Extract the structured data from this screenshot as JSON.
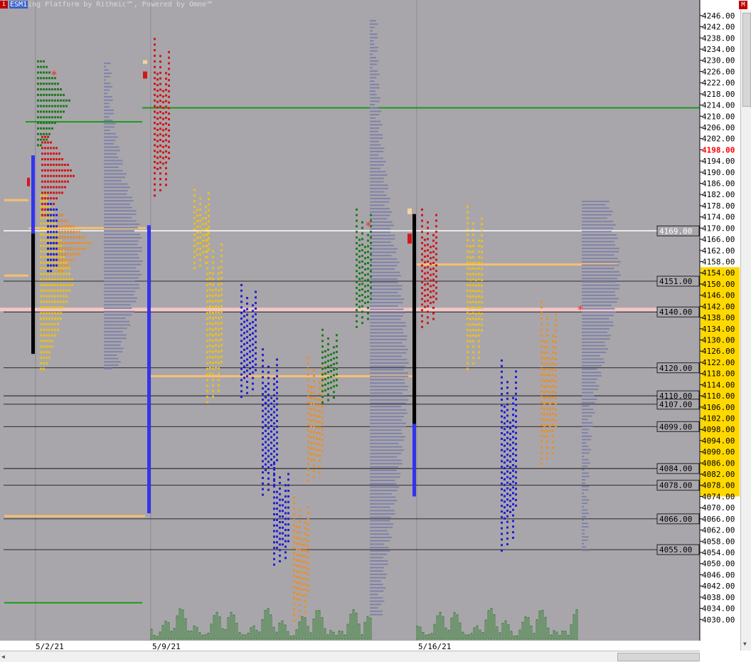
{
  "window": {
    "title_text": "ing Platform by Rithmic℠, Powered by Omne℠",
    "symbol": "ESM1",
    "close_glyph": "M",
    "icon_glyph": "i"
  },
  "colors": {
    "background": "#a9a6ab",
    "price_axis": "#ffffff",
    "profile_red": "#d01818",
    "profile_green": "#1e7a1e",
    "profile_yellow": "#e8c020",
    "profile_blue": "#2020d0",
    "profile_orange": "#e8902a",
    "initial_balance": "#3333ee",
    "volume_profile": "#7a7ea8",
    "green_ref_line": "#1a9a1a",
    "orange_ref_line": "#f5c070",
    "pink_band": "#f3c6c6",
    "white_line": "#ffffff",
    "axis_highlight": "#ffd800",
    "current_price_text": "#ff0000"
  },
  "chart_data": {
    "type": "market_profile",
    "instrument": "ESM1",
    "ylim": [
      4026,
      4248
    ],
    "tick_step": 4,
    "current_price": "4198.00",
    "x_labels": [
      "5/2/21",
      "5/9/21",
      "5/16/21"
    ],
    "highlight_axis_range": [
      4074,
      4156
    ],
    "level_labels": [
      "4169.00",
      "4151.00",
      "4140.00",
      "4120.00",
      "4110.00",
      "4107.00",
      "4099.00",
      "4084.00",
      "4078.00",
      "4066.00",
      "4055.00"
    ],
    "levels": [
      4169,
      4151,
      4140,
      4120,
      4110,
      4107,
      4099,
      4084,
      4078,
      4066,
      4055
    ],
    "ref_lines": [
      {
        "color": "green",
        "price": 4213,
        "span": "week2-onward"
      },
      {
        "color": "green",
        "price": 4208,
        "span": "week1"
      },
      {
        "color": "green",
        "price": 4036,
        "span": "week1"
      },
      {
        "color": "orange",
        "price": 4180,
        "span": "week1-left"
      },
      {
        "color": "orange",
        "price": 4153,
        "span": "week1-left"
      },
      {
        "color": "orange",
        "price": 4170,
        "span": "week1"
      },
      {
        "color": "orange",
        "price": 4117,
        "span": "week2"
      },
      {
        "color": "orange",
        "price": 4067,
        "span": "week1"
      },
      {
        "color": "orange",
        "price": 4157,
        "span": "week3"
      },
      {
        "color": "pink",
        "price": 4141,
        "span": "all"
      }
    ],
    "weeks": [
      {
        "label": "5/2/21",
        "open": 4185,
        "close": 4160,
        "high": 4231,
        "low": 4120,
        "ib_high": 4196,
        "ib_low": 4151,
        "sessions": [
          {
            "color": "green",
            "high": 4231,
            "low": 4200
          },
          {
            "color": "red",
            "high": 4204,
            "low": 4175
          },
          {
            "color": "yellow",
            "high": 4183,
            "low": 4120
          },
          {
            "color": "blue",
            "high": 4179,
            "low": 4155
          },
          {
            "color": "orange",
            "high": 4175,
            "low": 4155
          }
        ]
      },
      {
        "label": "5/9/21",
        "open": 4226,
        "close": 4085,
        "high": 4239,
        "low": 4030,
        "ib_high": 4171,
        "ib_low": 4068
      },
      {
        "label": "5/16/21",
        "open": 4178,
        "close": 4140,
        "high": 4179,
        "low": 4055,
        "ib_high": 4163,
        "ib_low": 4074
      }
    ],
    "daily_bars": [
      {
        "color": "red",
        "high": 4239,
        "low": 4182
      },
      {
        "color": "yellow",
        "high": 4185,
        "low": 4156
      },
      {
        "color": "yellow",
        "high": 4170,
        "low": 4108
      },
      {
        "color": "blue",
        "high": 4151,
        "low": 4110
      },
      {
        "color": "blue",
        "high": 4128,
        "low": 4075
      },
      {
        "color": "blue",
        "high": 4086,
        "low": 4050
      },
      {
        "color": "orange",
        "high": 4075,
        "low": 4030
      },
      {
        "color": "orange",
        "high": 4125,
        "low": 4080
      },
      {
        "color": "green",
        "high": 4134,
        "low": 4108
      },
      {
        "color": "green",
        "high": 4178,
        "low": 4135
      },
      {
        "color": "red",
        "high": 4178,
        "low": 4135
      },
      {
        "color": "yellow",
        "high": 4179,
        "low": 4120
      },
      {
        "color": "blue",
        "high": 4124,
        "low": 4055
      },
      {
        "color": "orange",
        "high": 4144,
        "low": 4086
      }
    ],
    "volume_profiles": [
      {
        "week": 1,
        "high": 4230,
        "low": 4120,
        "peak": 4160
      },
      {
        "week": 2,
        "high": 4245,
        "low": 4032,
        "peak": 4118
      },
      {
        "week": 3,
        "high": 4180,
        "low": 4055,
        "peak": 4155
      }
    ]
  }
}
